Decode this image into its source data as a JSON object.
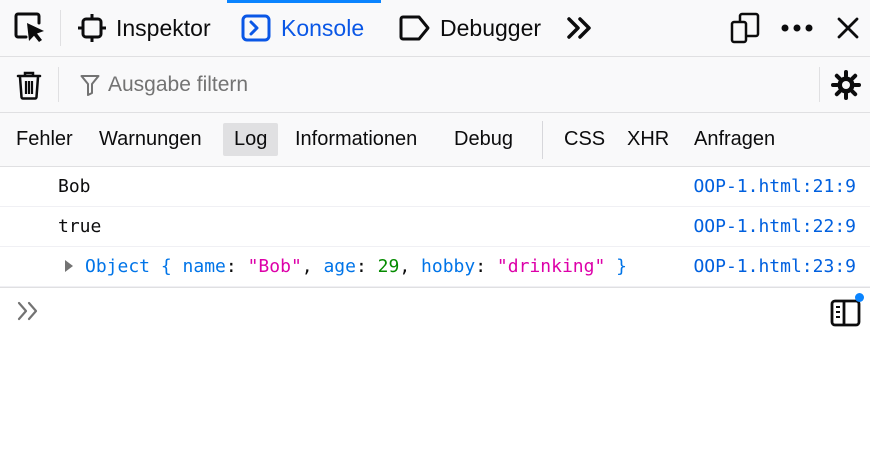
{
  "toolbar": {
    "tabs": [
      {
        "label": "Inspektor",
        "icon": "inspector-icon"
      },
      {
        "label": "Konsole",
        "icon": "console-icon",
        "selected": true
      },
      {
        "label": "Debugger",
        "icon": "debugger-icon"
      }
    ],
    "icons": [
      "element-picker-icon",
      "chevrons-more-icon",
      "dock-icon",
      "meatball-icon",
      "close-icon"
    ]
  },
  "filter": {
    "placeholder": "Ausgabe filtern",
    "value": ""
  },
  "levels": [
    {
      "label": "Fehler"
    },
    {
      "label": "Warnungen"
    },
    {
      "label": "Log",
      "active": true
    },
    {
      "label": "Informationen"
    },
    {
      "label": "Debug"
    },
    {
      "label": "CSS"
    },
    {
      "label": "XHR"
    },
    {
      "label": "Anfragen"
    }
  ],
  "messages": [
    {
      "text": "Bob",
      "location": "OOP-1.html:21:9"
    },
    {
      "text": "true",
      "location": "OOP-1.html:22:9"
    },
    {
      "object": {
        "prefix": "Object { ",
        "k1": "name",
        "v1": "\"Bob\"",
        "k2": "age",
        "v2": "29",
        "k3": "hobby",
        "v3": "\"drinking\"",
        "suffix": " }"
      },
      "location": "OOP-1.html:23:9"
    }
  ],
  "colors": {
    "accent": "#0a84ff",
    "link": "#0060df",
    "string": "#dd00a9",
    "number": "#058b00",
    "boolean": "#058b00",
    "object": "#0074e8"
  }
}
